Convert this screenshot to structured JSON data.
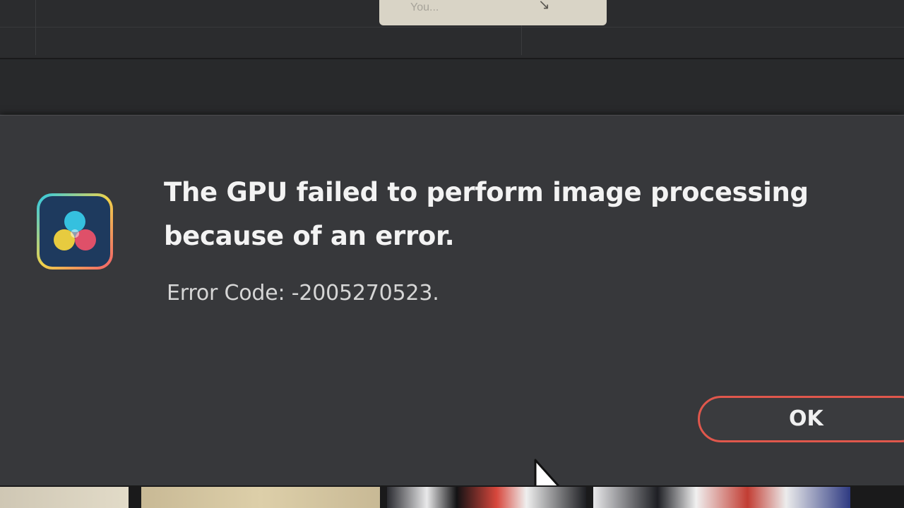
{
  "background_window": {
    "top_pill_text": "You...",
    "top_pill_glyph": "↘"
  },
  "dialog": {
    "title": "The GPU failed to perform image processing because of an error.",
    "error_code_text": "Error Code: -2005270523.",
    "ok_button_label": "OK",
    "app_icon": "davinci-resolve-icon",
    "ok_button_border_color": "#e0574c"
  }
}
